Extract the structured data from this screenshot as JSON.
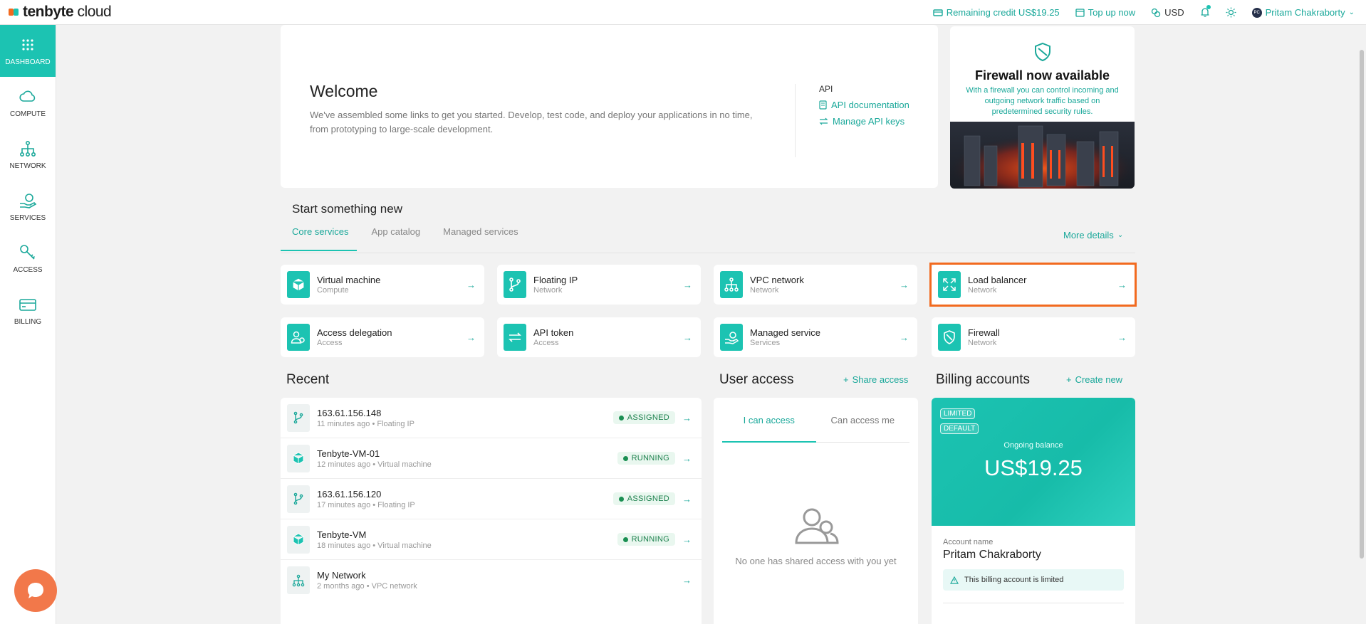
{
  "brand": {
    "name_bold": "tenbyte",
    "name_light": " cloud",
    "colors": [
      "#f26a1f",
      "#1cc3b2"
    ]
  },
  "header": {
    "credit": "Remaining credit US$19.25",
    "topup": "Top up now",
    "currency": "USD",
    "user": "Pritam Chakraborty",
    "user_initials": "PC"
  },
  "sidebar": {
    "items": [
      {
        "label": "Dashboard",
        "icon": "grid-icon"
      },
      {
        "label": "Compute",
        "icon": "cloud-icon"
      },
      {
        "label": "Network",
        "icon": "network-icon"
      },
      {
        "label": "Services",
        "icon": "services-icon"
      },
      {
        "label": "Access",
        "icon": "key-icon"
      },
      {
        "label": "Billing",
        "icon": "card-icon"
      }
    ]
  },
  "welcome": {
    "title": "Welcome",
    "text": "We've assembled some links to get you started. Develop, test code, and deploy your applications in no time, from prototyping to large-scale development.",
    "api_title": "API",
    "api_doc": "API documentation",
    "api_keys": "Manage API keys"
  },
  "promo": {
    "title": "Firewall now available",
    "text": "With a firewall you can control incoming and outgoing network traffic based on predetermined security rules."
  },
  "start": {
    "title": "Start something new",
    "tabs": [
      "Core services",
      "App catalog",
      "Managed services"
    ],
    "more": "More details",
    "tiles": [
      {
        "name": "Virtual machine",
        "category": "Compute"
      },
      {
        "name": "Floating IP",
        "category": "Network"
      },
      {
        "name": "VPC network",
        "category": "Network"
      },
      {
        "name": "Load balancer",
        "category": "Network"
      },
      {
        "name": "Access delegation",
        "category": "Access"
      },
      {
        "name": "API token",
        "category": "Access"
      },
      {
        "name": "Managed service",
        "category": "Services"
      },
      {
        "name": "Firewall",
        "category": "Network"
      }
    ]
  },
  "recent": {
    "title": "Recent",
    "items": [
      {
        "name": "163.61.156.148",
        "meta": "11 minutes ago • Floating IP",
        "status": "ASSIGNED"
      },
      {
        "name": "Tenbyte-VM-01",
        "meta": "12 minutes ago • Virtual machine",
        "status": "RUNNING"
      },
      {
        "name": "163.61.156.120",
        "meta": "17 minutes ago • Floating IP",
        "status": "ASSIGNED"
      },
      {
        "name": "Tenbyte-VM",
        "meta": "18 minutes ago • Virtual machine",
        "status": "RUNNING"
      },
      {
        "name": "My Network",
        "meta": "2 months ago • VPC network",
        "status": ""
      }
    ]
  },
  "user_access": {
    "title": "User access",
    "action": "Share access",
    "tabs": [
      "I can access",
      "Can access me"
    ],
    "empty": "No one has shared access with you yet"
  },
  "billing": {
    "title": "Billing accounts",
    "action": "Create new",
    "tags": [
      "LIMITED",
      "DEFAULT"
    ],
    "balance_label": "Ongoing balance",
    "balance": "US$19.25",
    "account_label": "Account name",
    "account_name": "Pritam Chakraborty",
    "warning": "This billing account is limited"
  }
}
